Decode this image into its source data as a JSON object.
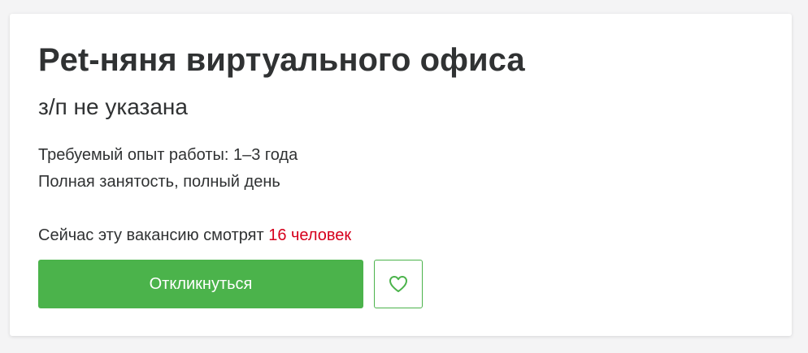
{
  "vacancy": {
    "title": "Pet-няня виртуального офиса",
    "salary": "з/п не указана",
    "experience": "Требуемый опыт работы: 1–3 года",
    "employment": "Полная занятость, полный день"
  },
  "viewers": {
    "prefix": "Сейчас эту вакансию смотрят ",
    "count": "16 человек"
  },
  "actions": {
    "apply_label": "Откликнуться",
    "favorite_icon": "heart-icon"
  },
  "colors": {
    "accent_green": "#4bb34b",
    "viewers_red": "#d6001c",
    "text": "#303233"
  }
}
